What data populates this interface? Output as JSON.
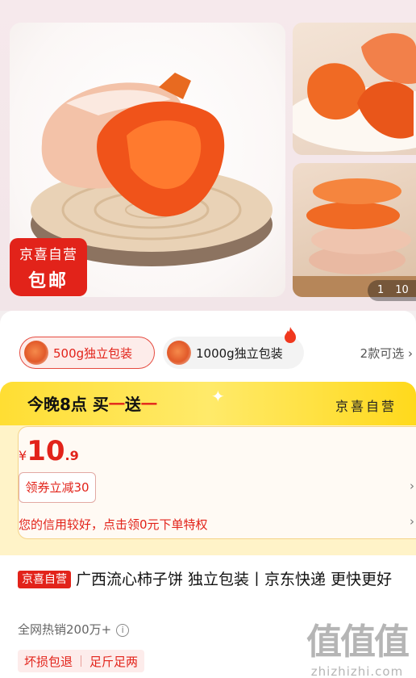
{
  "gallery": {
    "badge_line1": "京喜自营",
    "badge_line2": "包邮",
    "counter_current": "1",
    "counter_total": "10"
  },
  "variants": {
    "items": [
      {
        "label": "500g独立包装",
        "selected": true
      },
      {
        "label": "1000g独立包装",
        "selected": false
      }
    ],
    "more_label": "2款可选",
    "more_chevron": "›"
  },
  "promo": {
    "title_prefix": "今晚8点 买",
    "title_red1": "一",
    "title_mid": "送",
    "title_red2": "一",
    "right_label": "京喜自营"
  },
  "price": {
    "currency": "¥",
    "integer": "10",
    "decimal": ".9",
    "coupon_label": "领券立减30",
    "credit_text": "您的信用较好，点击领0元下单特权"
  },
  "product": {
    "tag": "京喜自营",
    "title": "广西流心柿子饼  独立包装丨京东快递 更快更好",
    "sales": "全网热销200万+",
    "services": [
      "坏损包退",
      "足斤足两"
    ]
  },
  "watermark": {
    "logo": "值值值",
    "site": "zhizhizhi.com"
  },
  "colors": {
    "brand_red": "#e2231a",
    "promo_yellow": "#ffde33"
  },
  "icons": {
    "info": "info-icon",
    "fire": "fire-icon",
    "chevron": "chevron-right-icon",
    "sparkle": "sparkle-icon"
  }
}
